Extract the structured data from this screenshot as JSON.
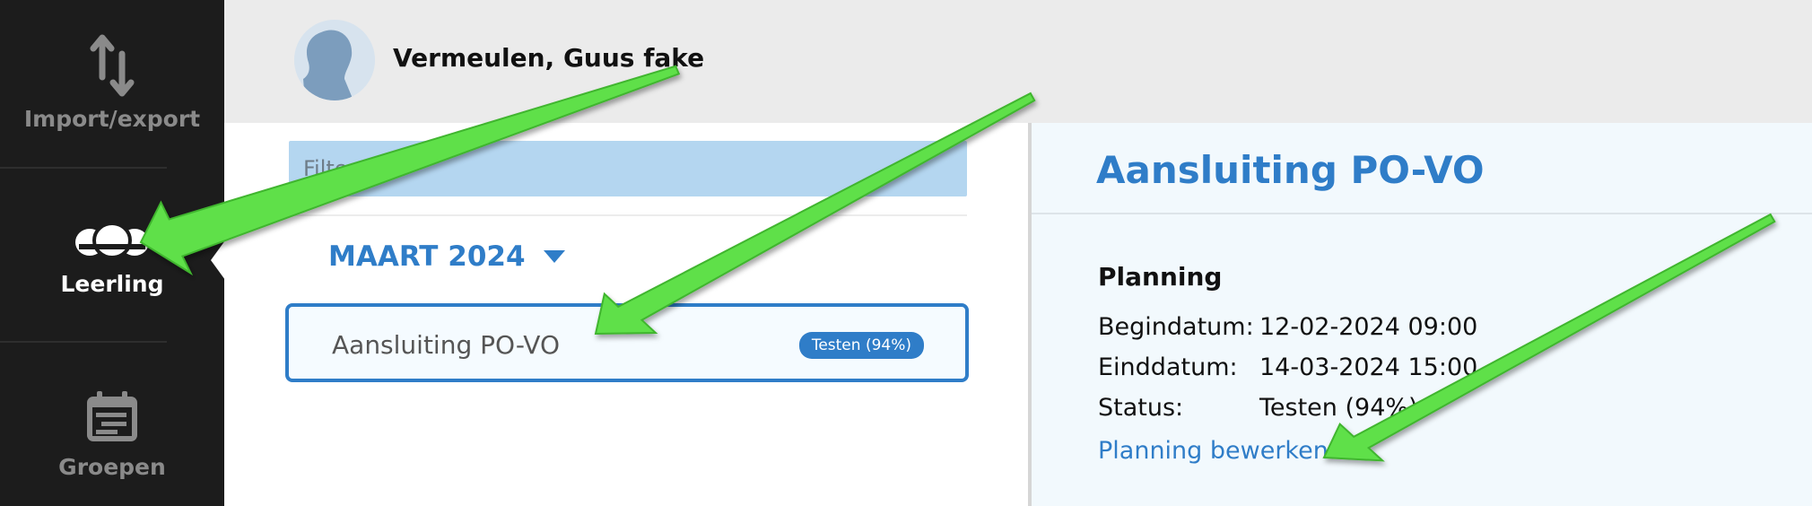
{
  "sidebar": {
    "items": [
      {
        "label": "Import/export",
        "icon": "import-export-icon",
        "active": false
      },
      {
        "label": "Leerling",
        "icon": "students-icon",
        "active": true
      },
      {
        "label": "Groepen",
        "icon": "groups-calendar-icon",
        "active": false
      }
    ]
  },
  "header": {
    "user_name": "Vermeulen, Guus fake"
  },
  "list": {
    "filter_placeholder": "Filter",
    "month_label": "MAART 2024",
    "items": [
      {
        "title": "Aansluiting PO-VO",
        "badge": "Testen (94%)"
      }
    ]
  },
  "detail": {
    "title": "Aansluiting PO-VO",
    "section": "Planning",
    "fields": [
      {
        "label": "Begindatum:",
        "value": "12-02-2024 09:00"
      },
      {
        "label": "Einddatum:",
        "value": "14-03-2024 15:00"
      },
      {
        "label": "Status:",
        "value": "Testen (94%)"
      }
    ],
    "edit_link": "Planning bewerken"
  },
  "colors": {
    "accent": "#2f7dc8",
    "sidebar_bg": "#1c1c1c",
    "arrow": "#5ee04a",
    "filter_bg": "#b4d6f0"
  }
}
